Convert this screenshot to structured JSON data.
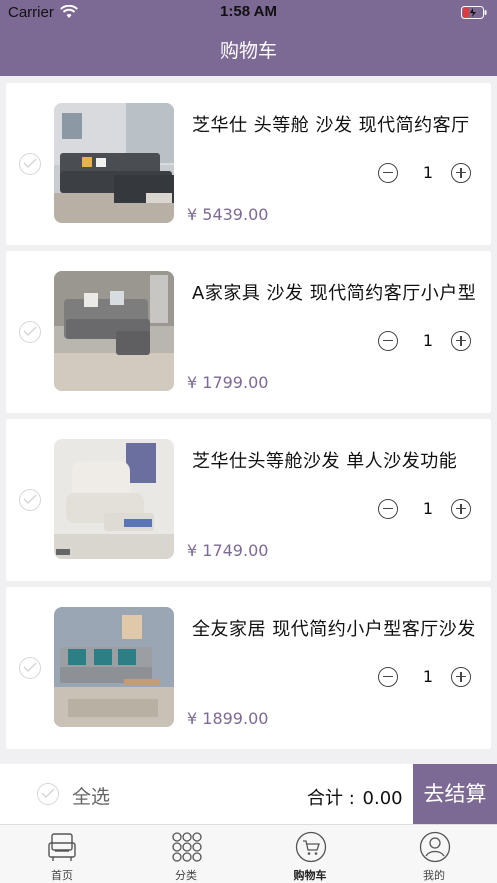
{
  "status": {
    "carrier": "Carrier",
    "time": "1:58 AM"
  },
  "nav": {
    "title": "购物车"
  },
  "items": [
    {
      "title": "芝华仕 头等舱 沙发 现代简约客厅",
      "qty": "1",
      "price": "¥ 5439.00"
    },
    {
      "title": "A家家具 沙发 现代简约客厅小户型",
      "qty": "1",
      "price": "¥ 1799.00"
    },
    {
      "title": "芝华仕头等舱沙发 单人沙发功能",
      "qty": "1",
      "price": "¥ 1749.00"
    },
    {
      "title": "全友家居 现代简约小户型客厅沙发",
      "qty": "1",
      "price": "¥ 1899.00"
    }
  ],
  "footer": {
    "select_all": "全选",
    "total_label": "合计 :",
    "total_value": "0.00",
    "checkout": "去结算"
  },
  "tabs": [
    {
      "label": "首页",
      "icon": "sofa-icon"
    },
    {
      "label": "分类",
      "icon": "grid-dots-icon"
    },
    {
      "label": "购物车",
      "icon": "cart-icon"
    },
    {
      "label": "我的",
      "icon": "user-icon"
    }
  ],
  "colors": {
    "accent": "#7c6a94",
    "background": "#f0f0f2"
  }
}
